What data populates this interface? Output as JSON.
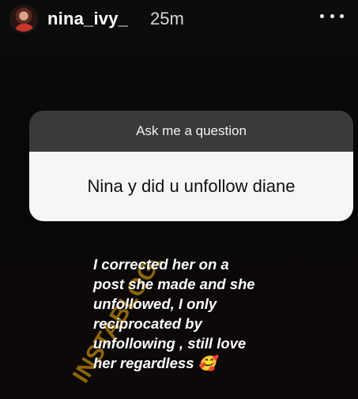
{
  "header": {
    "username": "nina_ivy_",
    "time_ago": "25m",
    "avatar_icon": "profile-avatar",
    "more_icon": "more-options-icon"
  },
  "question_sticker": {
    "prompt": "Ask me a question",
    "question": "Nina y did u unfollow diane"
  },
  "answer": {
    "lines": [
      "I corrected her on a",
      "post she made and she",
      "unfollowed, I only",
      "reciprocated by",
      "unfollowing , still love",
      "her regardless 🥰"
    ]
  },
  "watermark": {
    "text": "INSTABLOG9JA",
    "color": "#b8860b"
  }
}
